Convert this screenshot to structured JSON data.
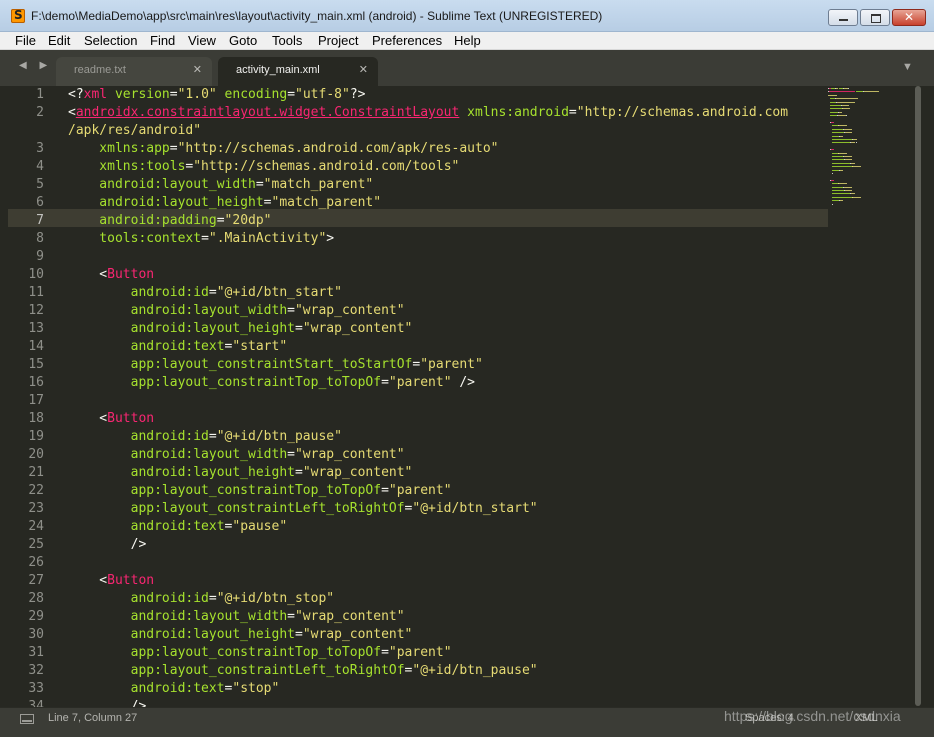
{
  "window": {
    "title": "F:\\demo\\MediaDemo\\app\\src\\main\\res\\layout\\activity_main.xml (android) - Sublime Text (UNREGISTERED)"
  },
  "menu": [
    "File",
    "Edit",
    "Selection",
    "Find",
    "View",
    "Goto",
    "Tools",
    "Project",
    "Preferences",
    "Help"
  ],
  "tabs": [
    {
      "label": "readme.txt",
      "active": false
    },
    {
      "label": "activity_main.xml",
      "active": true
    }
  ],
  "nav_arrows": "◀ ▶",
  "tab_close_glyph": "✕",
  "tab_dropdown_glyph": "▼",
  "editor": {
    "current_line": 7,
    "line_numbers": [
      "1",
      "2",
      "",
      "3",
      "4",
      "5",
      "6",
      "7",
      "8",
      "9",
      "10",
      "11",
      "12",
      "13",
      "14",
      "15",
      "16",
      "17",
      "18",
      "19",
      "20",
      "21",
      "22",
      "23",
      "24",
      "25",
      "26",
      "27",
      "28",
      "29",
      "30",
      "31",
      "32",
      "33",
      "34"
    ],
    "code_lines": [
      [
        [
          "p",
          "<?"
        ],
        [
          "t",
          "xml"
        ],
        [
          "a",
          " version"
        ],
        [
          "p",
          "="
        ],
        [
          "s",
          "\"1.0\""
        ],
        [
          "a",
          " encoding"
        ],
        [
          "p",
          "="
        ],
        [
          "s",
          "\"utf-8\""
        ],
        [
          "p",
          "?>"
        ]
      ],
      [
        [
          "p",
          "<"
        ],
        [
          "tu",
          "androidx.constraintlayout.widget.ConstraintLayout"
        ],
        [
          "a",
          " xmlns:android"
        ],
        [
          "p",
          "="
        ],
        [
          "s",
          "\"http://schemas.android.com"
        ]
      ],
      [
        [
          "s",
          "/apk/res/android\""
        ]
      ],
      [
        [
          "a",
          "    xmlns:app"
        ],
        [
          "p",
          "="
        ],
        [
          "s",
          "\"http://schemas.android.com/apk/res-auto\""
        ]
      ],
      [
        [
          "a",
          "    xmlns:tools"
        ],
        [
          "p",
          "="
        ],
        [
          "s",
          "\"http://schemas.android.com/tools\""
        ]
      ],
      [
        [
          "a",
          "    android:layout_width"
        ],
        [
          "p",
          "="
        ],
        [
          "s",
          "\"match_parent\""
        ]
      ],
      [
        [
          "a",
          "    android:layout_height"
        ],
        [
          "p",
          "="
        ],
        [
          "s",
          "\"match_parent\""
        ]
      ],
      [
        [
          "a",
          "    android:padding"
        ],
        [
          "p",
          "="
        ],
        [
          "s",
          "\"20dp\""
        ]
      ],
      [
        [
          "a",
          "    tools:context"
        ],
        [
          "p",
          "="
        ],
        [
          "s",
          "\".MainActivity\""
        ],
        [
          "p",
          ">"
        ]
      ],
      [
        [
          "p",
          ""
        ]
      ],
      [
        [
          "p",
          "    <"
        ],
        [
          "t",
          "Button"
        ]
      ],
      [
        [
          "a",
          "        android:id"
        ],
        [
          "p",
          "="
        ],
        [
          "s",
          "\"@+id/btn_start\""
        ]
      ],
      [
        [
          "a",
          "        android:layout_width"
        ],
        [
          "p",
          "="
        ],
        [
          "s",
          "\"wrap_content\""
        ]
      ],
      [
        [
          "a",
          "        android:layout_height"
        ],
        [
          "p",
          "="
        ],
        [
          "s",
          "\"wrap_content\""
        ]
      ],
      [
        [
          "a",
          "        android:text"
        ],
        [
          "p",
          "="
        ],
        [
          "s",
          "\"start\""
        ]
      ],
      [
        [
          "a",
          "        app:layout_constraintStart_toStartOf"
        ],
        [
          "p",
          "="
        ],
        [
          "s",
          "\"parent\""
        ]
      ],
      [
        [
          "a",
          "        app:layout_constraintTop_toTopOf"
        ],
        [
          "p",
          "="
        ],
        [
          "s",
          "\"parent\""
        ],
        [
          "p",
          " />"
        ]
      ],
      [
        [
          "p",
          ""
        ]
      ],
      [
        [
          "p",
          "    <"
        ],
        [
          "t",
          "Button"
        ]
      ],
      [
        [
          "a",
          "        android:id"
        ],
        [
          "p",
          "="
        ],
        [
          "s",
          "\"@+id/btn_pause\""
        ]
      ],
      [
        [
          "a",
          "        android:layout_width"
        ],
        [
          "p",
          "="
        ],
        [
          "s",
          "\"wrap_content\""
        ]
      ],
      [
        [
          "a",
          "        android:layout_height"
        ],
        [
          "p",
          "="
        ],
        [
          "s",
          "\"wrap_content\""
        ]
      ],
      [
        [
          "a",
          "        app:layout_constraintTop_toTopOf"
        ],
        [
          "p",
          "="
        ],
        [
          "s",
          "\"parent\""
        ]
      ],
      [
        [
          "a",
          "        app:layout_constraintLeft_toRightOf"
        ],
        [
          "p",
          "="
        ],
        [
          "s",
          "\"@+id/btn_start\""
        ]
      ],
      [
        [
          "a",
          "        android:text"
        ],
        [
          "p",
          "="
        ],
        [
          "s",
          "\"pause\""
        ]
      ],
      [
        [
          "p",
          "        />"
        ]
      ],
      [
        [
          "p",
          ""
        ]
      ],
      [
        [
          "p",
          "    <"
        ],
        [
          "t",
          "Button"
        ]
      ],
      [
        [
          "a",
          "        android:id"
        ],
        [
          "p",
          "="
        ],
        [
          "s",
          "\"@+id/btn_stop\""
        ]
      ],
      [
        [
          "a",
          "        android:layout_width"
        ],
        [
          "p",
          "="
        ],
        [
          "s",
          "\"wrap_content\""
        ]
      ],
      [
        [
          "a",
          "        android:layout_height"
        ],
        [
          "p",
          "="
        ],
        [
          "s",
          "\"wrap_content\""
        ]
      ],
      [
        [
          "a",
          "        app:layout_constraintTop_toTopOf"
        ],
        [
          "p",
          "="
        ],
        [
          "s",
          "\"parent\""
        ]
      ],
      [
        [
          "a",
          "        app:layout_constraintLeft_toRightOf"
        ],
        [
          "p",
          "="
        ],
        [
          "s",
          "\"@+id/btn_pause\""
        ]
      ],
      [
        [
          "a",
          "        android:text"
        ],
        [
          "p",
          "="
        ],
        [
          "s",
          "\"stop\""
        ]
      ],
      [
        [
          "p",
          "        />"
        ]
      ]
    ]
  },
  "colors": {
    "background": "#272822",
    "tag": "#f92672",
    "attribute": "#a6e22e",
    "string": "#e6db74",
    "plain": "#f8f8f2",
    "line_number": "#8f908a"
  },
  "status": {
    "position": "Line 7, Column 27",
    "spaces": "Spaces: 4",
    "syntax": "XML"
  },
  "watermark": "https://blog.csdn.net/csdnxia"
}
